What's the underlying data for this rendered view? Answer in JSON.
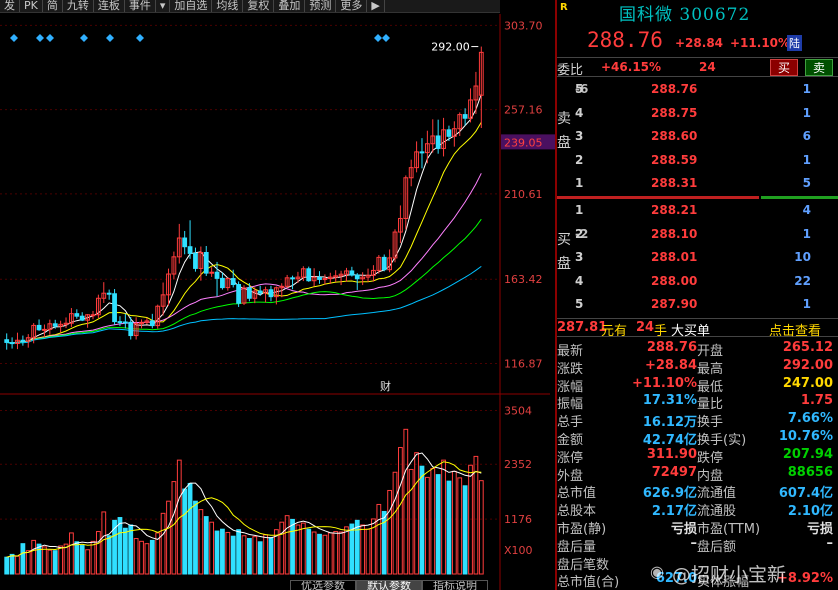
{
  "toolbar": {
    "items": [
      "发",
      "PK",
      "简",
      "九转",
      "连板",
      "事件",
      "▾",
      "加自选",
      "均线",
      "复权",
      "叠加",
      "预测",
      "更多",
      "▶"
    ]
  },
  "chart": {
    "price_ticks": [
      "303.70",
      "257.16",
      "210.61",
      "163.42",
      "116.87"
    ],
    "current_label": "239.05",
    "high_label": "292.00",
    "volume_ticks": [
      "3504",
      "2352",
      "1176",
      "X100"
    ],
    "fin_marker": "财"
  },
  "chart_data": {
    "type": "candlestick",
    "ohlc": [
      [
        130.0,
        133.5,
        124.5,
        128.5
      ],
      [
        128.4,
        131.3,
        125.1,
        127.9
      ],
      [
        127.9,
        133.9,
        124.8,
        129.7
      ],
      [
        129.7,
        132.3,
        126.7,
        129.2
      ],
      [
        129.2,
        133.1,
        125.6,
        131.1
      ],
      [
        131.1,
        139.2,
        128.0,
        137.9
      ],
      [
        137.9,
        141.2,
        134.9,
        135.5
      ],
      [
        135.5,
        138.4,
        131.3,
        135.7
      ],
      [
        135.7,
        141.1,
        132.7,
        138.8
      ],
      [
        138.8,
        141.0,
        136.1,
        137.5
      ],
      [
        137.5,
        140.5,
        133.9,
        138.5
      ],
      [
        138.5,
        142.3,
        136.4,
        139.1
      ],
      [
        139.1,
        147.5,
        137.0,
        144.4
      ],
      [
        144.4,
        146.8,
        141.6,
        143.0
      ],
      [
        143.0,
        145.2,
        140.3,
        140.8
      ],
      [
        140.8,
        144.2,
        136.6,
        143.8
      ],
      [
        143.8,
        145.9,
        141.3,
        143.8
      ],
      [
        143.8,
        154.9,
        142.0,
        152.9
      ],
      [
        152.9,
        161.8,
        150.3,
        155.7
      ],
      [
        155.7,
        157.7,
        152.1,
        155.4
      ],
      [
        155.4,
        158.0,
        138.3,
        140.0
      ],
      [
        140.0,
        143.0,
        137.5,
        139.8
      ],
      [
        139.8,
        144.4,
        136.2,
        139.6
      ],
      [
        139.6,
        142.6,
        130.1,
        132.3
      ],
      [
        132.3,
        142.4,
        130.1,
        138.9
      ],
      [
        138.9,
        141.2,
        136.3,
        139.6
      ],
      [
        139.6,
        142.1,
        138.4,
        140.4
      ],
      [
        140.4,
        144.3,
        136.3,
        137.8
      ],
      [
        137.8,
        149.4,
        136.1,
        148.5
      ],
      [
        148.5,
        161.6,
        143.4,
        154.8
      ],
      [
        154.8,
        169.3,
        148.8,
        166.3
      ],
      [
        166.3,
        178.7,
        163.3,
        175.8
      ],
      [
        175.8,
        194.0,
        172.1,
        186.2
      ],
      [
        186.2,
        190.1,
        177.2,
        181.4
      ],
      [
        181.4,
        196.0,
        174.7,
        177.7
      ],
      [
        177.7,
        180.9,
        167.6,
        169.4
      ],
      [
        169.4,
        181.5,
        162.6,
        178.2
      ],
      [
        178.2,
        181.8,
        165.2,
        166.8
      ],
      [
        166.8,
        170.1,
        164.7,
        167.3
      ],
      [
        167.3,
        173.0,
        154.0,
        163.9
      ],
      [
        163.9,
        167.1,
        157.7,
        158.8
      ],
      [
        158.8,
        164.4,
        157.1,
        163.8
      ],
      [
        163.8,
        168.7,
        158.9,
        160.5
      ],
      [
        160.5,
        162.2,
        148.1,
        150.2
      ],
      [
        150.2,
        160.1,
        149.2,
        158.6
      ],
      [
        158.6,
        161.3,
        151.2,
        152.9
      ],
      [
        152.9,
        159.0,
        150.2,
        156.9
      ],
      [
        156.9,
        159.8,
        154.2,
        155.8
      ],
      [
        155.8,
        159.3,
        150.6,
        157.6
      ],
      [
        157.6,
        159.8,
        151.2,
        153.8
      ],
      [
        153.8,
        159.4,
        149.5,
        158.7
      ],
      [
        158.7,
        161.2,
        153.5,
        159.5
      ],
      [
        159.5,
        165.8,
        158.6,
        164.2
      ],
      [
        164.2,
        165.4,
        157.9,
        163.7
      ],
      [
        163.7,
        167.5,
        161.4,
        164.6
      ],
      [
        164.6,
        170.6,
        162.4,
        169.2
      ],
      [
        169.2,
        170.4,
        162.0,
        162.6
      ],
      [
        162.6,
        169.5,
        159.5,
        164.5
      ],
      [
        164.5,
        167.9,
        160.9,
        163.3
      ],
      [
        163.3,
        166.1,
        160.4,
        163.8
      ],
      [
        163.8,
        167.0,
        160.8,
        164.6
      ],
      [
        164.6,
        168.4,
        161.9,
        165.3
      ],
      [
        165.3,
        168.1,
        160.2,
        166.2
      ],
      [
        166.2,
        169.7,
        162.0,
        168.0
      ],
      [
        168.0,
        170.3,
        164.9,
        165.7
      ],
      [
        165.7,
        166.8,
        157.5,
        163.7
      ],
      [
        163.7,
        167.3,
        160.2,
        164.6
      ],
      [
        164.6,
        169.3,
        161.9,
        165.6
      ],
      [
        165.6,
        171.2,
        162.1,
        168.3
      ],
      [
        168.3,
        176.8,
        166.5,
        175.5
      ],
      [
        175.5,
        177.1,
        167.8,
        168.7
      ],
      [
        168.7,
        179.9,
        167.3,
        175.2
      ],
      [
        175.2,
        191.0,
        172.8,
        189.5
      ],
      [
        189.5,
        204.2,
        183.4,
        197.0
      ],
      [
        197.0,
        220.8,
        191.0,
        219.5
      ],
      [
        219.5,
        229.5,
        214.8,
        225.1
      ],
      [
        225.1,
        239.6,
        222.5,
        233.8
      ],
      [
        233.8,
        241.4,
        224.7,
        233.4
      ],
      [
        233.4,
        245.5,
        227.5,
        238.3
      ],
      [
        238.3,
        251.8,
        233.4,
        242.6
      ],
      [
        242.6,
        251.6,
        232.8,
        235.7
      ],
      [
        235.7,
        252.6,
        231.3,
        246.0
      ],
      [
        246.0,
        248.3,
        239.8,
        242.4
      ],
      [
        242.4,
        250.7,
        236.7,
        246.6
      ],
      [
        246.6,
        255.6,
        242.6,
        254.4
      ],
      [
        254.4,
        257.9,
        248.4,
        252.4
      ],
      [
        252.4,
        268.9,
        250.1,
        262.5
      ],
      [
        262.5,
        278.0,
        254.8,
        270.2
      ],
      [
        265.1,
        292.0,
        247.0,
        288.8
      ]
    ],
    "volume": [
      360,
      420,
      380,
      650,
      500,
      720,
      640,
      580,
      510,
      500,
      600,
      640,
      880,
      690,
      610,
      520,
      700,
      910,
      1330,
      820,
      1150,
      1210,
      980,
      1050,
      760,
      700,
      650,
      720,
      880,
      1300,
      1560,
      1980,
      2440,
      1820,
      1940,
      1560,
      1380,
      1230,
      1110,
      920,
      960,
      890,
      810,
      950,
      820,
      760,
      800,
      690,
      840,
      780,
      950,
      1110,
      1250,
      1170,
      1050,
      1090,
      960,
      900,
      850,
      830,
      880,
      910,
      900,
      1010,
      1070,
      1150,
      1050,
      960,
      1180,
      1490,
      1340,
      1790,
      2180,
      2710,
      3100,
      2240,
      2600,
      2310,
      2070,
      2260,
      2130,
      2440,
      1990,
      2200,
      2060,
      1890,
      2330,
      2520,
      2000
    ],
    "volume_ticks": [
      3504,
      2352,
      1176
    ],
    "ylim": [
      100,
      310
    ],
    "price_ticks": [
      303.7,
      257.16,
      210.61,
      163.42,
      116.87
    ],
    "ma_colors": [
      "#ffffff",
      "#ffff00",
      "#ff80ff",
      "#00ff00",
      "#00c0ff"
    ]
  },
  "quote": {
    "r_tag": "R",
    "title": "国科微 300672",
    "price": "288.76",
    "change": "+28.84",
    "change_pct": "+11.10%",
    "market": "陆",
    "bid_ratio_label": "委比",
    "bid_ratio": "+46.15%",
    "bid_diff": "24",
    "buy_btn": "买",
    "sell_btn": "卖",
    "sell_label_a": "卖",
    "sell_label_b": "盘",
    "buy_label_a": "买",
    "buy_label_b": "盘",
    "asks": [
      {
        "lv": "5",
        "px": "288.76",
        "vol": "1",
        "chg": "-6"
      },
      {
        "lv": "4",
        "px": "288.75",
        "vol": "1",
        "chg": ""
      },
      {
        "lv": "3",
        "px": "288.60",
        "vol": "6",
        "chg": ""
      },
      {
        "lv": "2",
        "px": "288.59",
        "vol": "1",
        "chg": ""
      },
      {
        "lv": "1",
        "px": "288.31",
        "vol": "5",
        "chg": ""
      }
    ],
    "bids": [
      {
        "lv": "1",
        "px": "288.21",
        "vol": "4",
        "chg": ""
      },
      {
        "lv": "2",
        "px": "288.10",
        "vol": "1",
        "chg": "-2"
      },
      {
        "lv": "3",
        "px": "288.01",
        "vol": "10",
        "chg": ""
      },
      {
        "lv": "4",
        "px": "288.00",
        "vol": "22",
        "chg": ""
      },
      {
        "lv": "5",
        "px": "287.90",
        "vol": "1",
        "chg": ""
      }
    ],
    "trade_price": "287.81",
    "trade_yuan": "元有",
    "trade_lots": "24",
    "trade_hand": "手",
    "trade_big": "大买单",
    "trade_click": "点击查看",
    "stats": [
      {
        "l1": "最新",
        "v1": "288.76",
        "c1": "red",
        "l2": "开盘",
        "v2": "265.12",
        "c2": "red"
      },
      {
        "l1": "涨跌",
        "v1": "+28.84",
        "c1": "red",
        "l2": "最高",
        "v2": "292.00",
        "c2": "red"
      },
      {
        "l1": "涨幅",
        "v1": "+11.10%",
        "c1": "red",
        "l2": "最低",
        "v2": "247.00",
        "c2": "yel"
      },
      {
        "l1": "振幅",
        "v1": "17.31%",
        "c1": "cyan",
        "l2": "量比",
        "v2": "1.75",
        "c2": "red"
      },
      {
        "l1": "总手",
        "v1": "16.12万",
        "c1": "cyan",
        "l2": "换手",
        "v2": "7.66%",
        "c2": "cyan"
      },
      {
        "l1": "金额",
        "v1": "42.74亿",
        "c1": "cyan",
        "l2": "换手(实)",
        "v2": "10.76%",
        "c2": "cyan"
      },
      {
        "l1": "涨停",
        "v1": "311.90",
        "c1": "red",
        "l2": "跌停",
        "v2": "207.94",
        "c2": "grn"
      },
      {
        "l1": "外盘",
        "v1": "72497",
        "c1": "red",
        "l2": "内盘",
        "v2": "88656",
        "c2": "grn"
      },
      {
        "l1": "总市值",
        "v1": "626.9亿",
        "c1": "cyan",
        "l2": "流通值",
        "v2": "607.4亿",
        "c2": "cyan"
      },
      {
        "l1": "总股本",
        "v1": "2.17亿",
        "c1": "cyan",
        "l2": "流通股",
        "v2": "2.10亿",
        "c2": "cyan"
      },
      {
        "l1": "市盈(静)",
        "v1": "亏损",
        "c1": "wht",
        "l2": "市盈(TTM)",
        "v2": "亏损",
        "c2": "wht"
      },
      {
        "l1": "盘后量",
        "v1": "–",
        "c1": "wht",
        "l2": "盘后额",
        "v2": "–",
        "c2": "wht"
      },
      {
        "l1": "盘后笔数",
        "v1": "",
        "c1": "wht",
        "l2": "",
        "v2": "",
        "c2": "wht"
      },
      {
        "l1": "总市值(合)",
        "v1": "627.0",
        "c1": "cyan",
        "l2": "实体涨幅",
        "v2": "+8.92%",
        "c2": "red"
      }
    ]
  },
  "bottom_tabs": [
    "优选参数",
    "默认参数",
    "指标说明"
  ],
  "watermark": "@招财小宝新"
}
